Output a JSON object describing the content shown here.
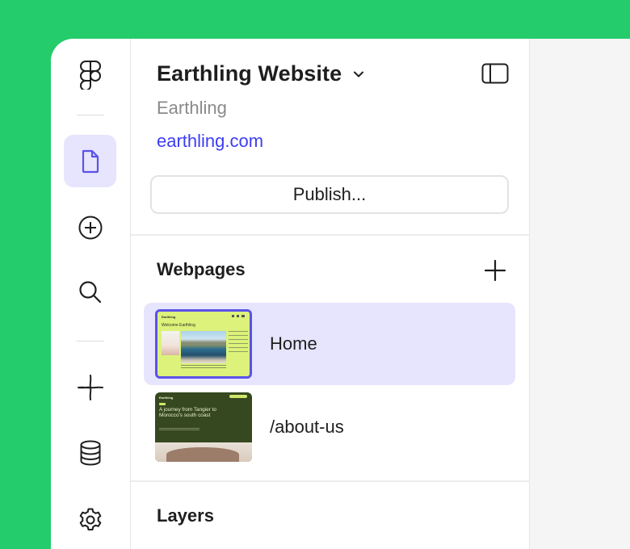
{
  "site": {
    "name": "Earthling Website",
    "team": "Earthling",
    "url": "earthling.com",
    "publish_label": "Publish..."
  },
  "sections": {
    "webpages": "Webpages",
    "layers": "Layers"
  },
  "pages": [
    {
      "label": "Home",
      "selected": true,
      "thumbnail": {
        "brand": "Earthling",
        "heading": "Welcome Earthling"
      }
    },
    {
      "label": "/about-us",
      "selected": false,
      "thumbnail": {
        "brand": "Earthling",
        "heading": "A journey from Tangier to Morocco's south coast"
      }
    }
  ],
  "rail": {
    "icons": [
      "figma-logo-icon",
      "page-icon",
      "add-circle-icon",
      "search-icon",
      "component-icon",
      "database-icon",
      "settings-icon"
    ],
    "active": "page-icon"
  },
  "colors": {
    "background": "#24cc6b",
    "accent": "#3d3df5",
    "selection": "#e6e5fd"
  }
}
